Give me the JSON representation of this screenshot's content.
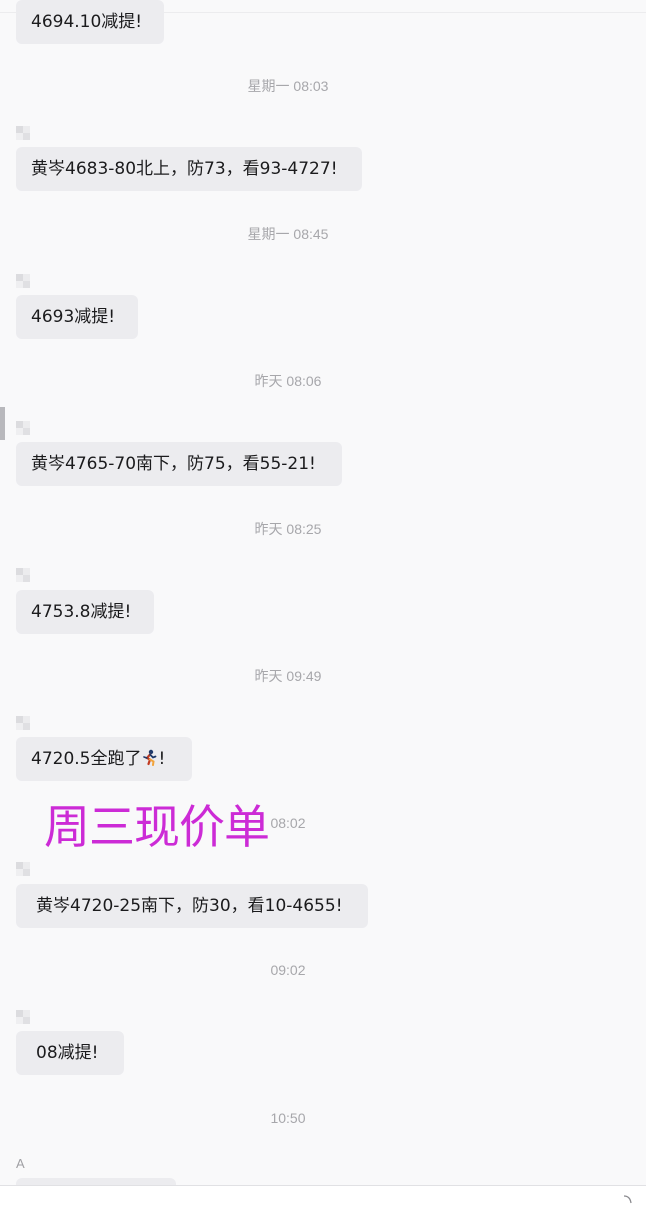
{
  "chat": {
    "messages": [
      {
        "text": "4694.10减提!"
      },
      {
        "time": "星期一 08:03",
        "text": "黄岑4683-80北上，防73，看93-4727!"
      },
      {
        "time": "星期一 08:45",
        "text": "4693减提!"
      },
      {
        "time": "昨天 08:06",
        "text": "黄岑4765-70南下，防75，看55-21!"
      },
      {
        "time": "昨天 08:25",
        "text": "4753.8减提!"
      },
      {
        "time": "昨天 09:49",
        "text_before": "4720.5全跑了",
        "emoji": "running-person",
        "text_after": "!"
      },
      {
        "time": "08:02",
        "text": "黄岑4720-25南下，防30，看10-4655!"
      },
      {
        "time": "09:02",
        "text": "08减提!"
      },
      {
        "time": "10:50",
        "sender": "A"
      }
    ],
    "overlay_banner": "周三现价单"
  },
  "colors": {
    "background": "#f9f9fa",
    "bubble": "#ececef",
    "timestamp": "#a7a7ab",
    "banner": "#cc2bd6"
  }
}
